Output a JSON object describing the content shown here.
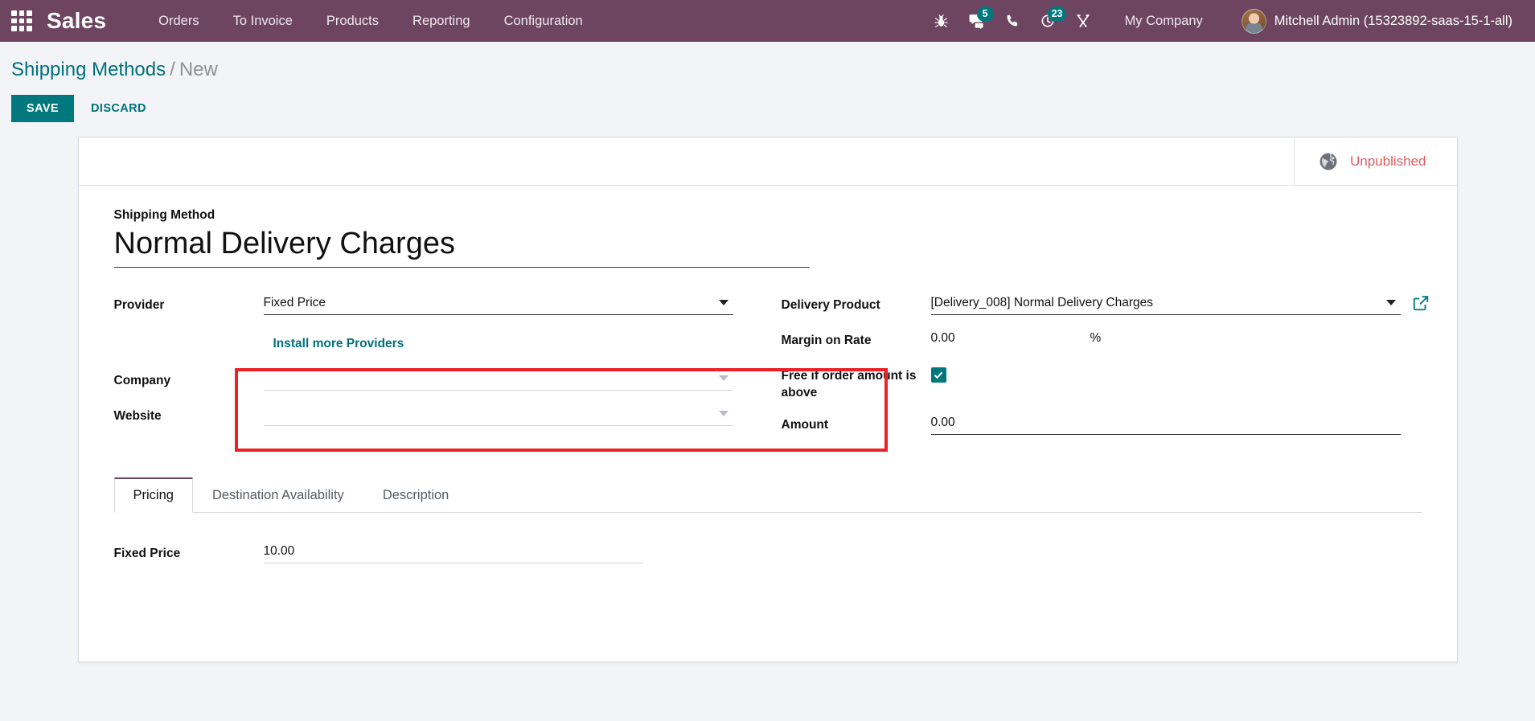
{
  "navbar": {
    "apps_icon": "apps-grid-icon",
    "brand": "Sales",
    "menu": [
      {
        "label": "Orders"
      },
      {
        "label": "To Invoice"
      },
      {
        "label": "Products"
      },
      {
        "label": "Reporting"
      },
      {
        "label": "Configuration"
      }
    ],
    "sys_icons": [
      {
        "name": "bug-icon",
        "badge": ""
      },
      {
        "name": "messages-icon",
        "badge": "5"
      },
      {
        "name": "phone-icon",
        "badge": ""
      },
      {
        "name": "activities-clock-icon",
        "badge": "23"
      },
      {
        "name": "tools-icon",
        "badge": ""
      }
    ],
    "company": "My Company",
    "user": "Mitchell Admin (15323892-saas-15-1-all)",
    "accent_color": "#6d4560",
    "badge_color": "#00787e"
  },
  "control_panel": {
    "breadcrumb_root": "Shipping Methods",
    "breadcrumb_sep": "/",
    "breadcrumb_current": "New",
    "save_label": "SAVE",
    "discard_label": "DISCARD",
    "save_color": "#00787e"
  },
  "statusbar": {
    "publish_icon": "globe-icon",
    "publish_state": "Unpublished",
    "publish_color": "#e05c5c"
  },
  "form": {
    "title_label": "Shipping Method",
    "title_value": "Normal Delivery Charges",
    "left_fields": [
      {
        "label": "Provider",
        "value": "Fixed Price",
        "type": "select",
        "state": "filled"
      },
      {
        "label": "Company",
        "value": "",
        "type": "select",
        "state": "empty"
      },
      {
        "label": "Website",
        "value": "",
        "type": "select",
        "state": "empty"
      }
    ],
    "install_more_link": "Install more Providers",
    "right_fields": [
      {
        "label": "Delivery Product",
        "value": "[Delivery_008] Normal Delivery Charges",
        "type": "many2one",
        "state": "filled"
      },
      {
        "label": "Margin on Rate",
        "value": "0.00",
        "suffix": "%",
        "type": "number",
        "state": "plain"
      }
    ],
    "highlighted": {
      "checkbox_label": "Free if order amount is above",
      "checkbox_checked": true,
      "amount_label": "Amount",
      "amount_value": "0.00",
      "highlight_color": "#ec2027"
    }
  },
  "notebook": {
    "tabs": [
      {
        "label": "Pricing",
        "active": true
      },
      {
        "label": "Destination Availability",
        "active": false
      },
      {
        "label": "Description",
        "active": false
      }
    ],
    "pricing": {
      "fixed_price_label": "Fixed Price",
      "fixed_price_value": "10.00"
    }
  }
}
